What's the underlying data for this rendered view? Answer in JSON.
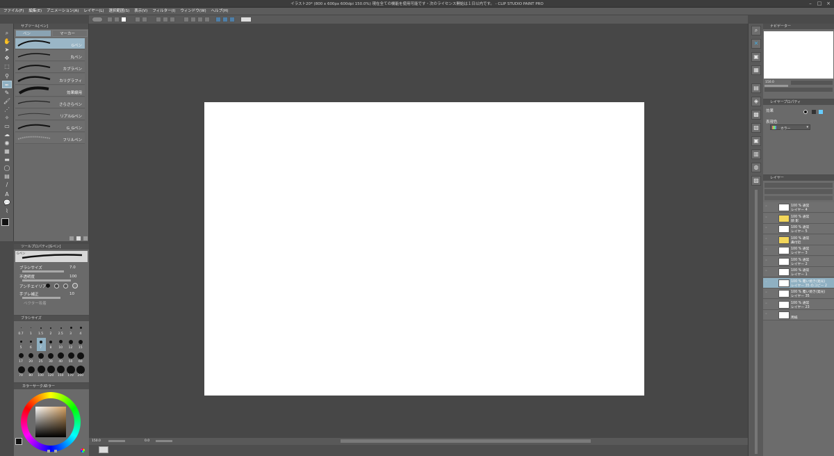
{
  "app": {
    "title": "イラスト20* (800 x 600px 600dpi 150.0%)  現在全ての機能を使用可能です・次のライセンス開始は１日以内です。 - CLIP STUDIO PAINT PRO"
  },
  "menu": [
    "ファイル(F)",
    "編集(E)",
    "アニメーション(A)",
    "レイヤー(L)",
    "選択範囲(S)",
    "表示(V)",
    "フィルター(I)",
    "ウィンドウ(W)",
    "ヘルプ(H)"
  ],
  "subtool": {
    "header": "サブツール[ペン]",
    "tabs": [
      "ペン",
      "マーカー"
    ],
    "brushes": [
      "Gペン",
      "丸ペン",
      "カブラペン",
      "カリグラフィ",
      "効果線用",
      "さらさらペン",
      "リアルGペン",
      "G_Gペン",
      "フリルペン"
    ],
    "selected_index": 0
  },
  "toolprop": {
    "header": "ツールプロパティ[Gペン]",
    "brush_name": "Gペン",
    "brush_size_label": "ブラシサイズ",
    "brush_size_value": "7.0",
    "opacity_label": "不透明度",
    "opacity_value": "100",
    "antialias_label": "アンチエイリアス",
    "stabilization_label": "手ブレ補正",
    "stabilization_value": "10",
    "vector_label": "ベクター吸着"
  },
  "brushsize": {
    "header": "ブラシサイズ",
    "row1": [
      "0.7",
      "1",
      "1.5",
      "2",
      "2.5",
      "3",
      "4"
    ],
    "row2": [
      "5",
      "6",
      "7",
      "8",
      "10",
      "12",
      "15"
    ],
    "row3": [
      "17",
      "20",
      "25",
      "30",
      "40",
      "50",
      "60"
    ],
    "row4": [
      "70",
      "80",
      "100",
      "120",
      "150",
      "170",
      "200"
    ]
  },
  "colorwheel": {
    "tabs": [
      "カラーサークル",
      "カラー"
    ],
    "hue_color": "#d4a060"
  },
  "navigator": {
    "header": "ナビゲーター",
    "zoom": "150.0"
  },
  "layerprop": {
    "header": "レイヤープロパティ",
    "effect_label": "効果",
    "display_color_label": "表現色",
    "display_color_value": "カラー"
  },
  "layers": {
    "header": "レイヤー",
    "items": [
      {
        "l1": "100 % 通常",
        "l2": "レイヤー 4",
        "selected": false
      },
      {
        "l1": "100 % 通常",
        "l2": "顔 影",
        "selected": false
      },
      {
        "l1": "100 % 通常",
        "l2": "レイヤー 5",
        "selected": false
      },
      {
        "l1": "100 % 通常",
        "l2": "鼻付近",
        "selected": false
      },
      {
        "l1": "100 % 通常",
        "l2": "レイヤー 3",
        "selected": false
      },
      {
        "l1": "100 % 通常",
        "l2": "レイヤー 2",
        "selected": false
      },
      {
        "l1": "100 % 通常",
        "l2": "レイヤー 1",
        "selected": false
      },
      {
        "l1": "100 % 覆い焼き(発光)",
        "l2": "レイヤー 35 のコピー 2",
        "selected": true
      },
      {
        "l1": "100 % 覆い焼き(発光)",
        "l2": "レイヤー 35",
        "selected": false
      },
      {
        "l1": "100 % 通常",
        "l2": "レイヤー 23",
        "selected": false
      },
      {
        "l1": "",
        "l2": "用紙",
        "selected": false
      }
    ]
  },
  "status": {
    "zoom": "150.0",
    "angle": "0.0"
  }
}
